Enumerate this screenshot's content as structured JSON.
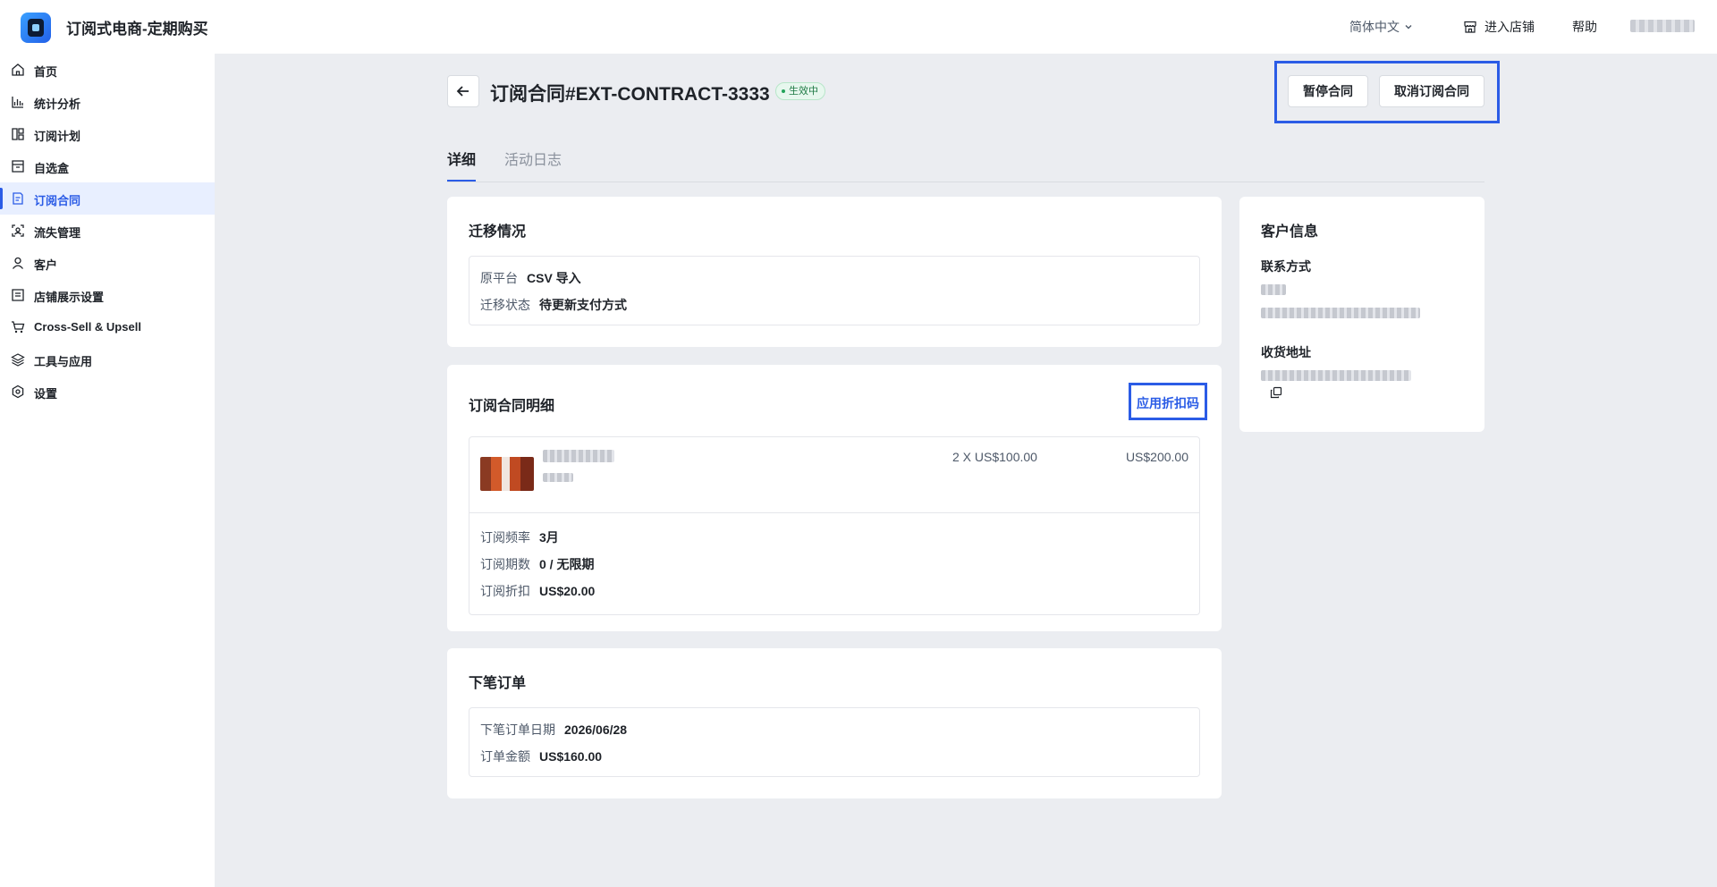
{
  "app": {
    "title": "订阅式电商-定期购买"
  },
  "topbar": {
    "language": "简体中文",
    "store_link": "进入店铺",
    "help": "帮助"
  },
  "sidebar": {
    "items": [
      {
        "label": "首页",
        "icon": "home-icon"
      },
      {
        "label": "统计分析",
        "icon": "chart-icon"
      },
      {
        "label": "订阅计划",
        "icon": "plan-icon"
      },
      {
        "label": "自选盒",
        "icon": "box-icon"
      },
      {
        "label": "订阅合同",
        "icon": "contract-icon",
        "active": true
      },
      {
        "label": "流失管理",
        "icon": "churn-icon"
      },
      {
        "label": "客户",
        "icon": "user-icon"
      },
      {
        "label": "店铺展示设置",
        "icon": "display-icon"
      },
      {
        "label": "Cross-Sell & Upsell",
        "icon": "cart-icon"
      },
      {
        "label": "工具与应用",
        "icon": "layers-icon"
      },
      {
        "label": "设置",
        "icon": "settings-icon"
      }
    ]
  },
  "header": {
    "title": "订阅合同#EXT-CONTRACT-3333",
    "status": "生效中",
    "pause_button": "暂停合同",
    "cancel_button": "取消订阅合同"
  },
  "tabs": {
    "detail": "详细",
    "activity_log": "活动日志"
  },
  "migration": {
    "title": "迁移情况",
    "platform_label": "原平台",
    "platform_value": "CSV 导入",
    "status_label": "迁移状态",
    "status_value": "待更新支付方式"
  },
  "contract_detail": {
    "title": "订阅合同明细",
    "apply_discount": "应用折扣码",
    "line_item": {
      "quantity_price": "2 X US$100.00",
      "total": "US$200.00"
    },
    "frequency_label": "订阅频率",
    "frequency_value": "3月",
    "cycles_label": "订阅期数",
    "cycles_value": "0 / 无限期",
    "discount_label": "订阅折扣",
    "discount_value": "US$20.00"
  },
  "next_order": {
    "title": "下笔订单",
    "date_label": "下笔订单日期",
    "date_value": "2026/06/28",
    "amount_label": "订单金额",
    "amount_value": "US$160.00"
  },
  "customer": {
    "title": "客户信息",
    "contact_label": "联系方式",
    "address_label": "收货地址"
  },
  "colors": {
    "accent": "#2b5ce6",
    "background": "#ebedf1",
    "status_green": "#1f7a45"
  }
}
